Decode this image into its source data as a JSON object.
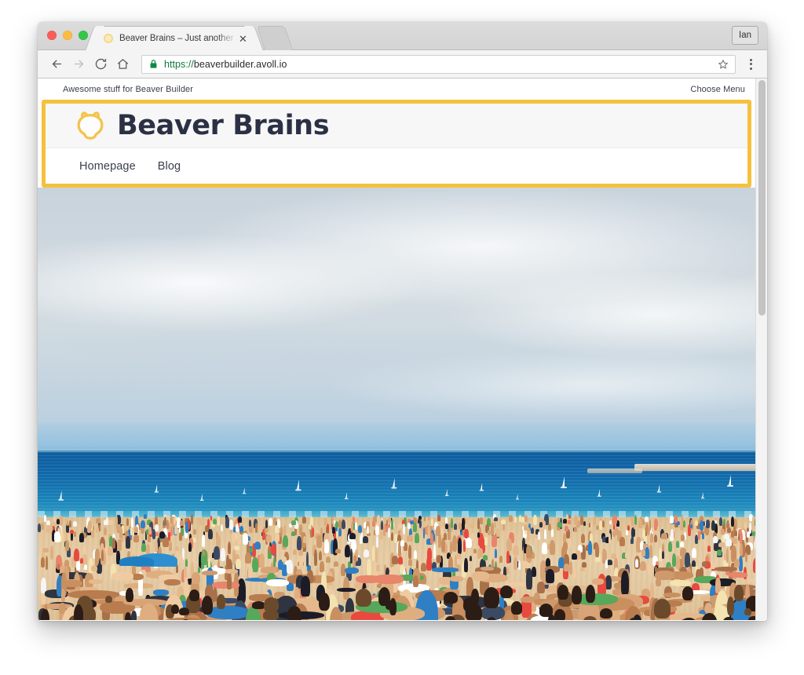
{
  "browser": {
    "window_controls": [
      {
        "name": "close",
        "color": "#fc5d57"
      },
      {
        "name": "minimize",
        "color": "#fdbc40"
      },
      {
        "name": "zoom",
        "color": "#33c748"
      }
    ],
    "tab": {
      "title": "Beaver Brains – Just another W",
      "favicon": "beaver-logo-icon",
      "close_label": "✕"
    },
    "profile_label": "Ian",
    "toolbar": {
      "back_label": "←",
      "forward_label": "→",
      "reload_label": "⟳",
      "home_label": "⌂",
      "lock_icon": "secure-lock-icon",
      "url_scheme": "https://",
      "url_host": "beaverbuilder.avoll.io",
      "bookmark_icon": "star-icon",
      "menu_icon": "three-dot-menu-icon"
    }
  },
  "site": {
    "utility_bar": {
      "tagline": "Awesome stuff for Beaver Builder",
      "choose_menu": "Choose Menu"
    },
    "header": {
      "highlight_color": "#f5c13d",
      "logo_icon": "beaver-head-logo-icon",
      "brand_name": "Beaver Brains",
      "brand_color": "#2b3045",
      "nav": [
        {
          "label": "Homepage"
        },
        {
          "label": "Blog"
        }
      ]
    },
    "hero": {
      "alt": "Crowded sunny beach with sea, sailboats and cloudy sky",
      "sky_color": "#ccd6de",
      "ocean_color": "#1370ad",
      "sand_color": "#e3c79c"
    }
  },
  "scrollbar": {
    "orientation": "vertical",
    "position": "top"
  }
}
